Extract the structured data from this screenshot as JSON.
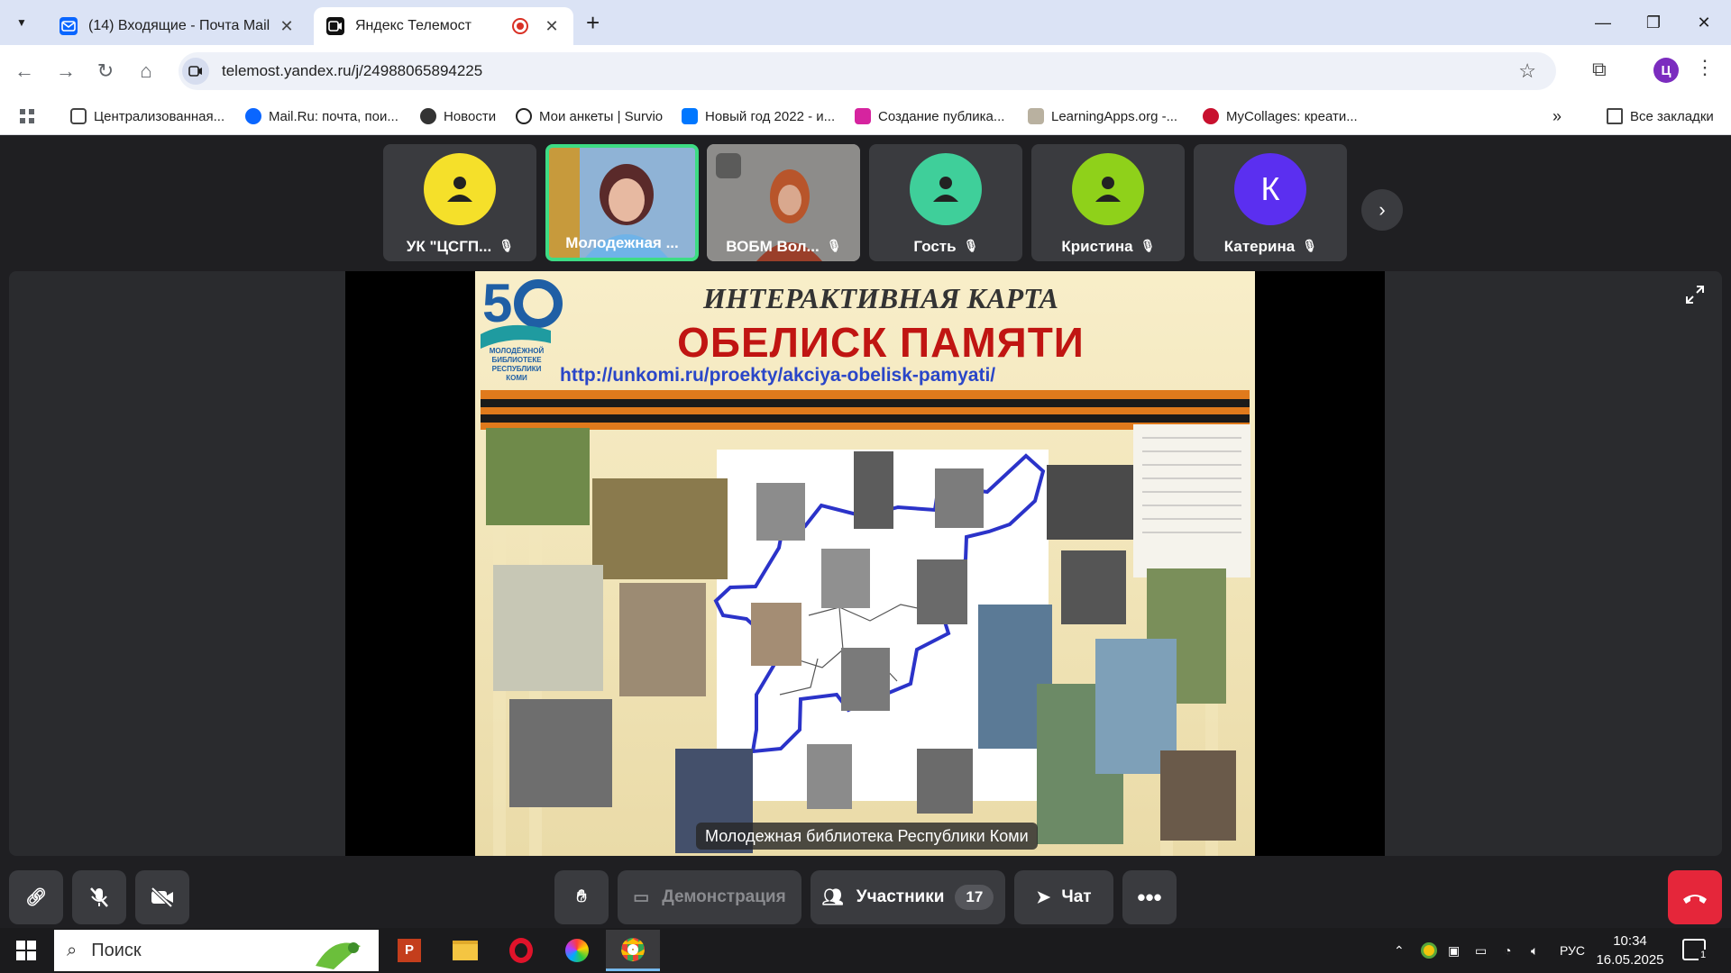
{
  "browser": {
    "tabs": [
      {
        "title": "(14) Входящие - Почта Mail",
        "favicon": "mail-icon",
        "active": false
      },
      {
        "title": "Яндекс Телемост",
        "favicon": "telemost-icon",
        "active": true,
        "recording": true
      }
    ],
    "address": "telemost.yandex.ru/j/24988065894225",
    "profile_initial": "Ц",
    "bookmarks": [
      {
        "label": "Централизованная...",
        "icon": "book-icon"
      },
      {
        "label": "Mail.Ru: почта, пои...",
        "icon": "mailru-icon"
      },
      {
        "label": "Новости",
        "icon": "globe-icon"
      },
      {
        "label": "Мои анкеты | Survio",
        "icon": "survio-icon"
      },
      {
        "label": "Новый год 2022 - и...",
        "icon": "vk-icon"
      },
      {
        "label": "Создание публика...",
        "icon": "instagram-icon"
      },
      {
        "label": "LearningApps.org -...",
        "icon": "learningapps-icon"
      },
      {
        "label": "MyCollages: креати...",
        "icon": "mycollages-icon"
      }
    ],
    "all_bookmarks": "Все закладки"
  },
  "participants": [
    {
      "name": "УК \"ЦСГП...",
      "avatar_type": "icon",
      "color": "#f5e02a",
      "muted": true
    },
    {
      "name": "Молодежная ...",
      "avatar_type": "video",
      "muted": false,
      "speaking": true
    },
    {
      "name": "ВОБМ Вол...",
      "avatar_type": "video",
      "muted": true
    },
    {
      "name": "Гость",
      "avatar_type": "icon",
      "color": "#3fcf9a",
      "muted": true
    },
    {
      "name": "Кристина",
      "avatar_type": "icon",
      "color": "#8fd11a",
      "muted": true
    },
    {
      "name": "Катерина",
      "avatar_type": "letter",
      "letter": "К",
      "color": "#5b2ff0",
      "muted": true
    }
  ],
  "slide": {
    "title_top": "ИНТЕРАКТИВНАЯ КАРТА",
    "title_main": "ОБЕЛИСК ПАМЯТИ",
    "url": "http://unkomi.ru/proekty/akciya-obelisk-pamyati/",
    "logo_number": "50",
    "logo_text": "МОЛОДЁЖНОЙ БИБЛИОТЕКЕ РЕСПУБЛИКИ КОМИ"
  },
  "caption": "Молодежная библиотека Республики Коми",
  "controls": {
    "demo": "Демонстрация",
    "participants_label": "Участники",
    "participants_count": "17",
    "chat": "Чат"
  },
  "taskbar": {
    "search_placeholder": "Поиск",
    "language": "РУС",
    "time": "10:34",
    "date": "16.05.2025",
    "notifications": "1"
  }
}
